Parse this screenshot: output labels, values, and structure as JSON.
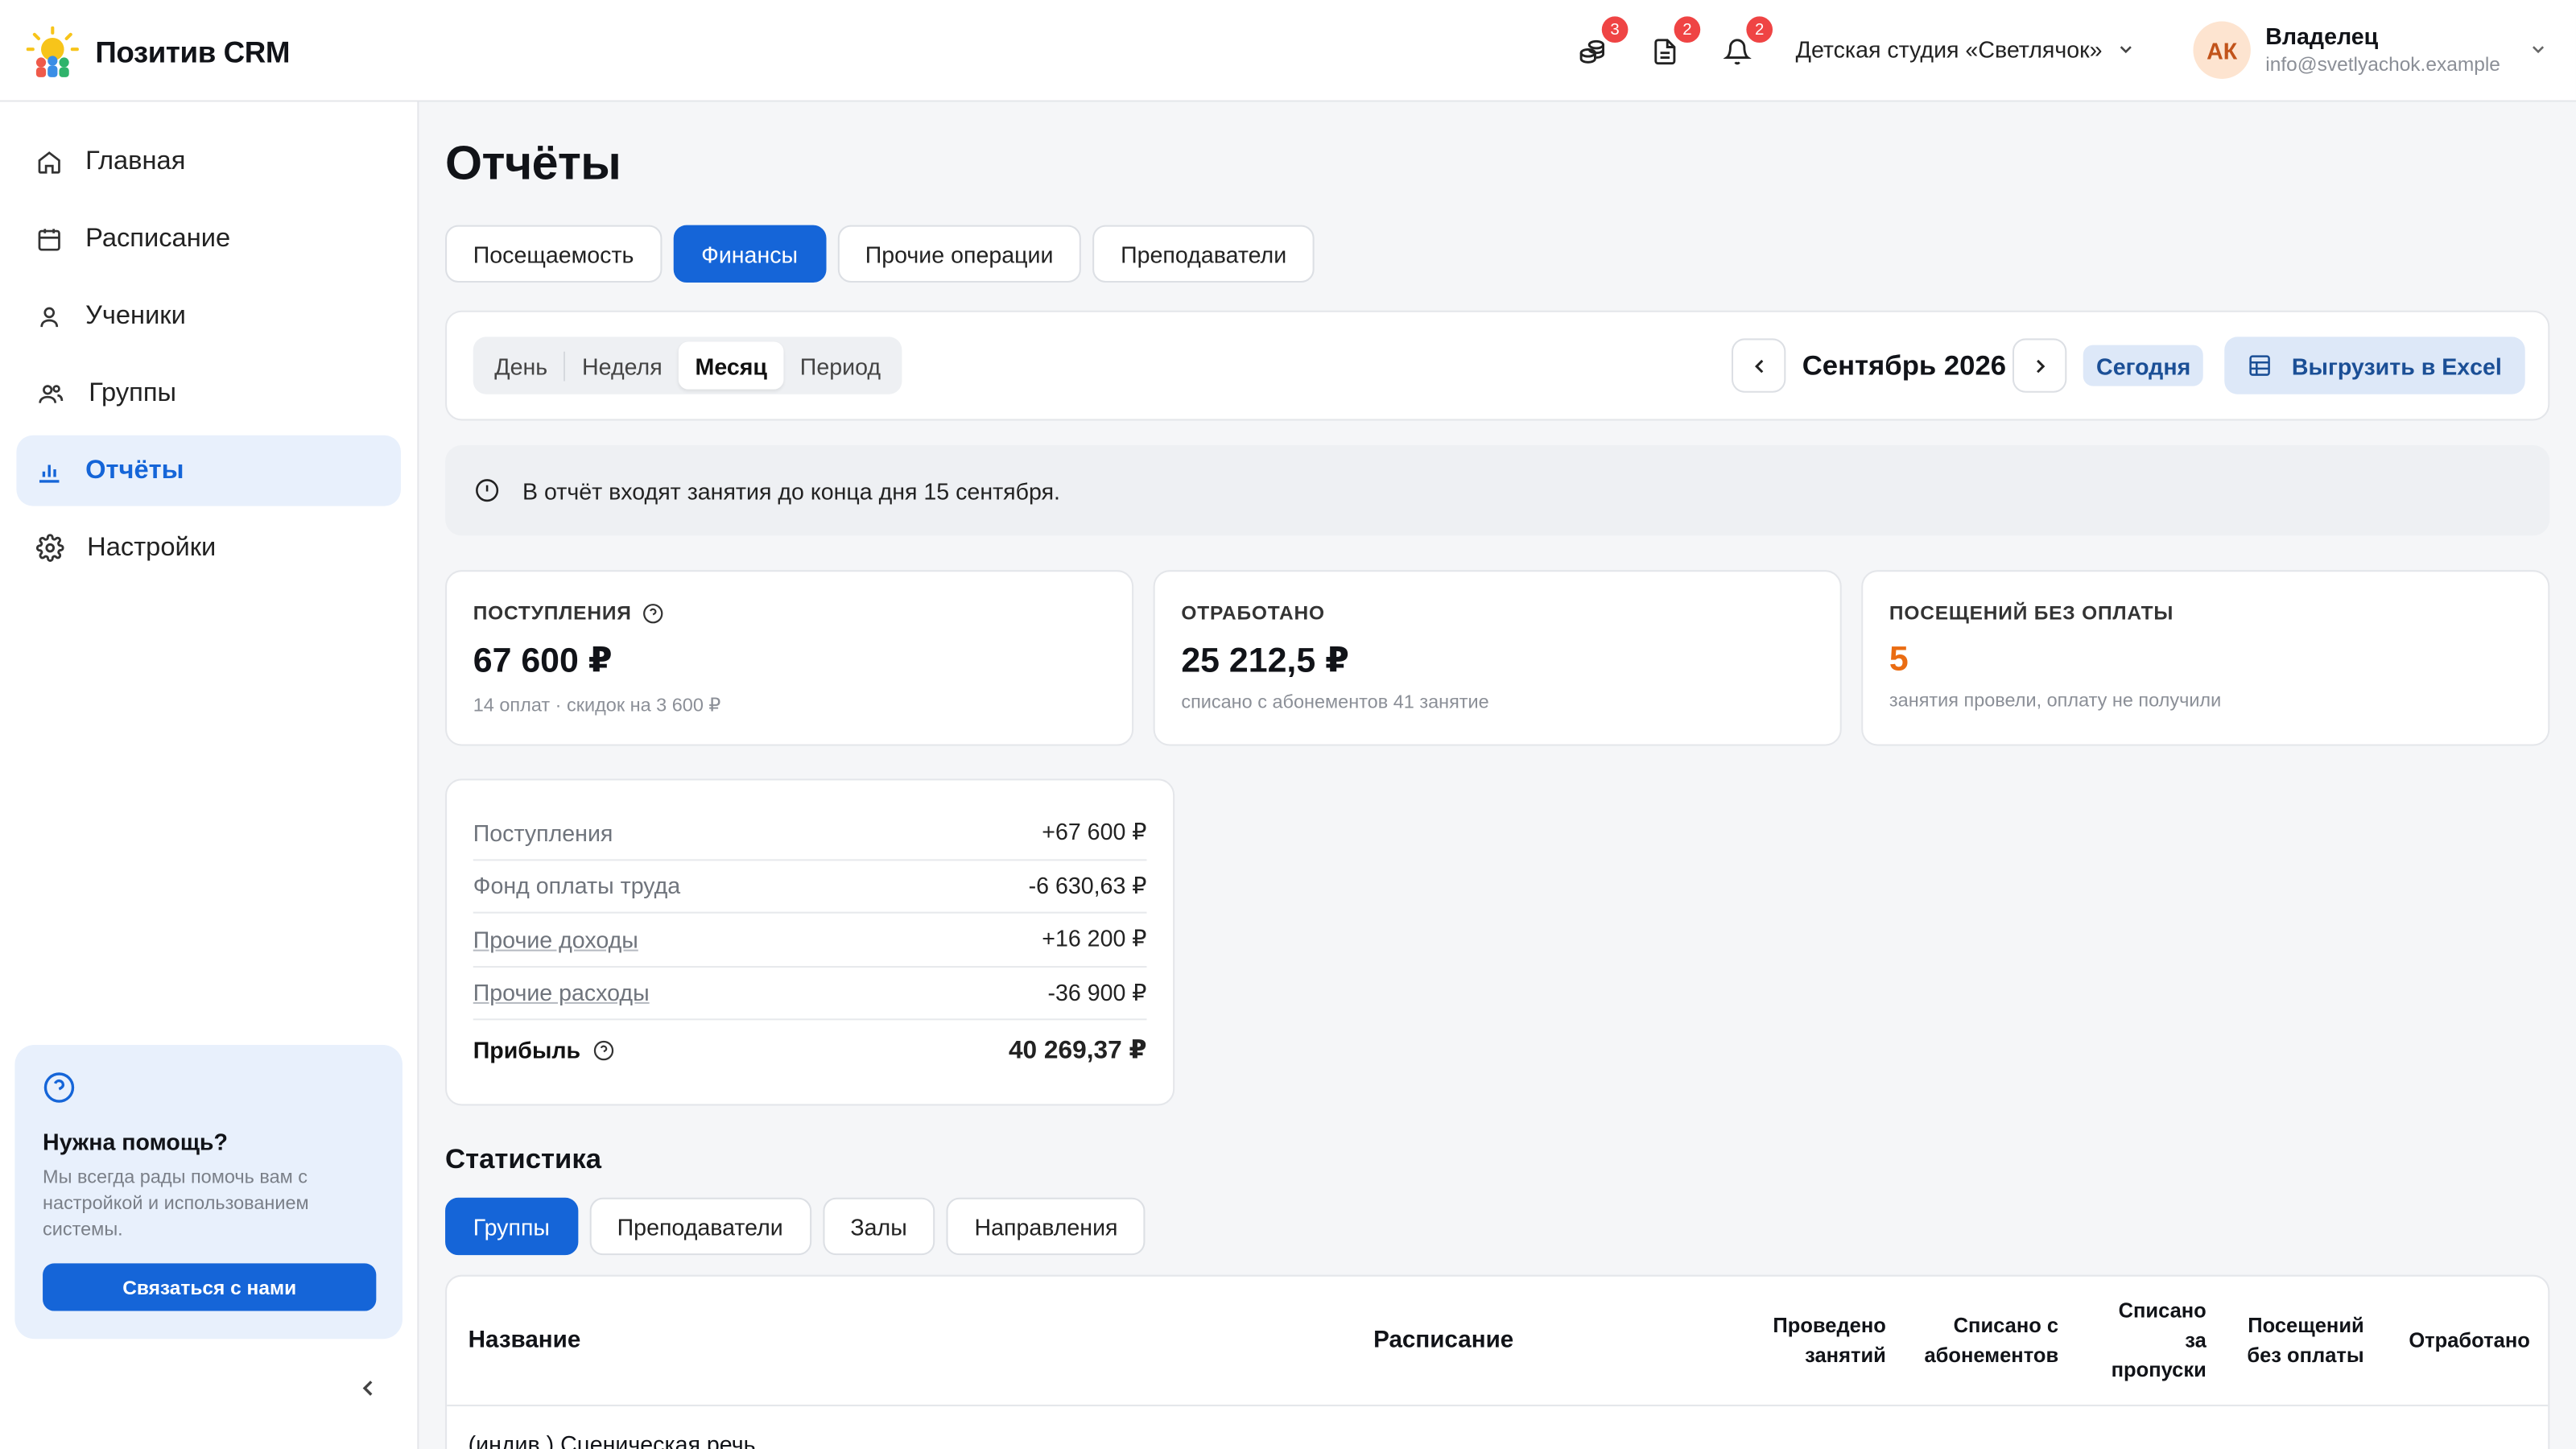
{
  "app": {
    "name": "Позитив CRM"
  },
  "header": {
    "badges": {
      "finance": "3",
      "documents": "2",
      "notifications": "2"
    },
    "studio": "Детская студия «Светлячок»",
    "user": {
      "initials": "АК",
      "role": "Владелец",
      "email": "info@svetlyachok.example"
    }
  },
  "sidebar": {
    "items": [
      {
        "label": "Главная",
        "icon": "home-icon"
      },
      {
        "label": "Расписание",
        "icon": "calendar-icon"
      },
      {
        "label": "Ученики",
        "icon": "user-icon"
      },
      {
        "label": "Группы",
        "icon": "users-icon"
      },
      {
        "label": "Отчёты",
        "icon": "chart-icon",
        "active": true
      },
      {
        "label": "Настройки",
        "icon": "gear-icon"
      }
    ],
    "help": {
      "title": "Нужна помощь?",
      "text": "Мы всегда рады помочь вам с настройкой и использованием системы.",
      "button": "Связаться с нами"
    }
  },
  "page": {
    "title": "Отчёты",
    "tabs": [
      "Посещаемость",
      "Финансы",
      "Прочие операции",
      "Преподаватели"
    ],
    "active_tab": "Финансы"
  },
  "filter": {
    "periods": [
      "День",
      "Неделя",
      "Месяц",
      "Период"
    ],
    "active_period": "Месяц",
    "current": "Сентябрь 2026",
    "today": "Сегодня",
    "export": "Выгрузить в Excel"
  },
  "notice": "В отчёт входят занятия до конца дня 15 сентября.",
  "kpis": [
    {
      "label": "ПОСТУПЛЕНИЯ",
      "value": "67 600 ₽",
      "sub": "14 оплат · скидок на 3 600 ₽"
    },
    {
      "label": "ОТРАБОТАНО",
      "value": "25 212,5 ₽",
      "sub": "списано с абонементов 41 занятие"
    },
    {
      "label": "ПОСЕЩЕНИЙ БЕЗ ОПЛАТЫ",
      "value": "5",
      "sub": "занятия провели, оплату не получили"
    }
  ],
  "summary": {
    "rows": [
      {
        "label": "Поступления",
        "value": "+67 600 ₽"
      },
      {
        "label": "Фонд оплаты труда",
        "value": "-6 630,63 ₽"
      },
      {
        "label": "Прочие доходы",
        "value": "+16 200 ₽"
      },
      {
        "label": "Прочие расходы",
        "value": "-36 900 ₽"
      }
    ],
    "total": {
      "label": "Прибыль",
      "value": "40 269,37 ₽"
    }
  },
  "stats": {
    "title": "Статистика",
    "tabs": [
      "Группы",
      "Преподаватели",
      "Залы",
      "Направления"
    ],
    "active_tab": "Группы",
    "columns": {
      "name": "Название",
      "schedule": "Расписание",
      "held": "Проведено занятий",
      "written_off": "Списано с абонементов",
      "absences": "Списано за пропуски",
      "unpaid": "Посещений без оплаты",
      "earned": "Отработано"
    },
    "first_row": "(индив.) Сценическая речь"
  },
  "colors": {
    "accent": "#1565d8",
    "orange": "#ea6c12",
    "badge": "#ef4444"
  }
}
